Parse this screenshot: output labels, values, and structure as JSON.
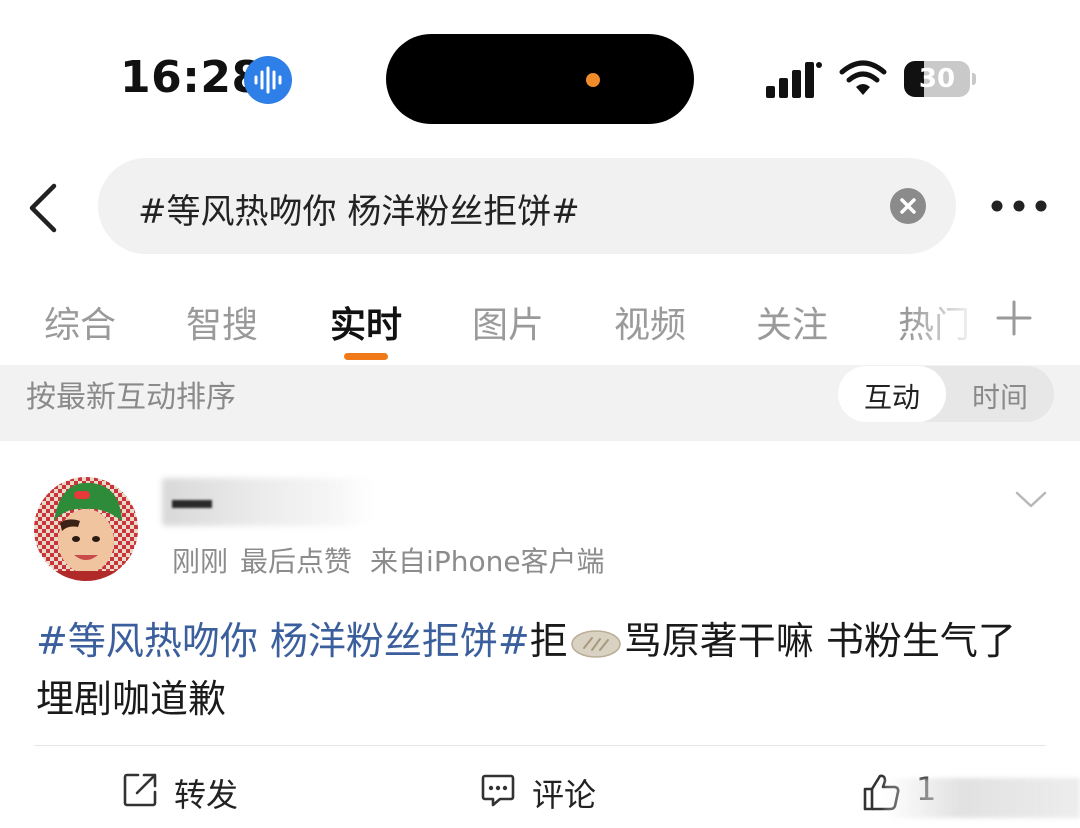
{
  "status_bar": {
    "time": "16:28",
    "battery_level": "30",
    "icons": [
      "voice-assistant-icon",
      "signal-icon",
      "wifi-icon",
      "battery-icon"
    ]
  },
  "header": {
    "search_query": "#等风热吻你 杨洋粉丝拒饼#",
    "icons": [
      "back-icon",
      "clear-icon",
      "more-icon"
    ]
  },
  "tabs": [
    {
      "label": "综合",
      "active": false
    },
    {
      "label": "智搜",
      "active": false
    },
    {
      "label": "实时",
      "active": true
    },
    {
      "label": "图片",
      "active": false
    },
    {
      "label": "视频",
      "active": false
    },
    {
      "label": "关注",
      "active": false
    },
    {
      "label": "热门",
      "active": false
    }
  ],
  "sort_bar": {
    "label": "按最新互动排序",
    "options": [
      "互动",
      "时间"
    ],
    "selected": "互动"
  },
  "post": {
    "time": "刚刚",
    "status": "最后点赞",
    "source": "来自",
    "device": "iPhone客户端",
    "hashtag": "#等风热吻你 杨洋粉丝拒饼#",
    "text_before_emoji": "拒",
    "emoji": "bread-emoji",
    "text_after_emoji": "骂原著干嘛 书粉生气了",
    "line2": "埋剧咖道歉"
  },
  "actions": {
    "repost": "转发",
    "comment": "评论",
    "like_count": "1"
  },
  "colors": {
    "accent": "#f07a1a",
    "hashtag": "#3b5f9d",
    "voice_icon": "#2f7fe8"
  }
}
